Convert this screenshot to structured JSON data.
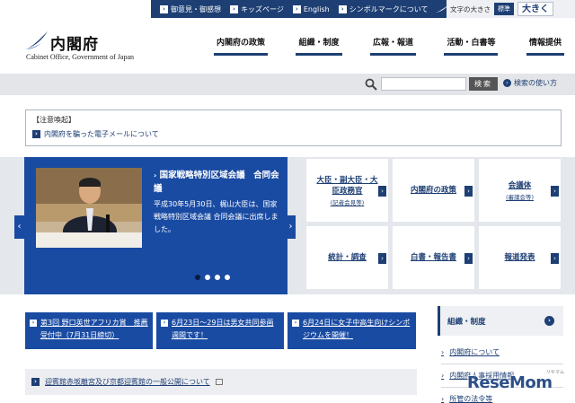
{
  "topbar": {
    "links": [
      "御意見・御感想",
      "キッズページ",
      "English",
      "シンボルマークについて"
    ],
    "text_size_label": "文字の大きさ",
    "text_size_standard": "標準",
    "text_size_large": "大きく"
  },
  "header": {
    "logo_jp": "内閣府",
    "logo_en": "Cabinet Office, Government of Japan",
    "nav": [
      "内閣府の政策",
      "組織・制度",
      "広報・報道",
      "活動・白書等",
      "情報提供"
    ]
  },
  "search": {
    "placeholder": "",
    "button": "検索",
    "help": "検索の使い方"
  },
  "notice": {
    "title": "【注意喚起】",
    "link": "内閣府を騙った電子メールについて"
  },
  "carousel": {
    "title": "国家戦略特別区域会議　合同会議",
    "title_arrow": "›",
    "body": "平成30年5月30日、梶山大臣は、国家戦略特別区域会議 合同会議に出席しました。",
    "prev": "‹",
    "next": "›",
    "dots_total": 4,
    "active_dot": 1
  },
  "tiles": [
    {
      "title": "大臣・副大臣・大臣政務官",
      "sub": "(記者会見等)"
    },
    {
      "title": "内閣府の政策",
      "sub": ""
    },
    {
      "title": "会議体",
      "sub": "(審議会等)"
    },
    {
      "title": "統計・調査",
      "sub": ""
    },
    {
      "title": "白書・報告書",
      "sub": ""
    },
    {
      "title": "報道発表",
      "sub": ""
    }
  ],
  "news": [
    "第3回 野口英世アフリカ賞　推薦受付中（7月31日締切）",
    "6月23日～29日は男女共同参画週間です！",
    "6月24日に女子中高生向けシンポジウムを開催！"
  ],
  "bottom_link": "迎賓館赤坂離宮及び京都迎賓館の一般公開について",
  "sidebar": {
    "heading": "組織・制度",
    "items": [
      "内閣府について",
      "内閣府人事採用情報",
      "所管の法令等"
    ]
  },
  "watermark": {
    "text": "ReseMom",
    "sub": "リセマム"
  },
  "colors": {
    "navy": "#1e3f74",
    "carousel_blue": "#1a4ba3",
    "band_gray": "#e4e7eb"
  }
}
